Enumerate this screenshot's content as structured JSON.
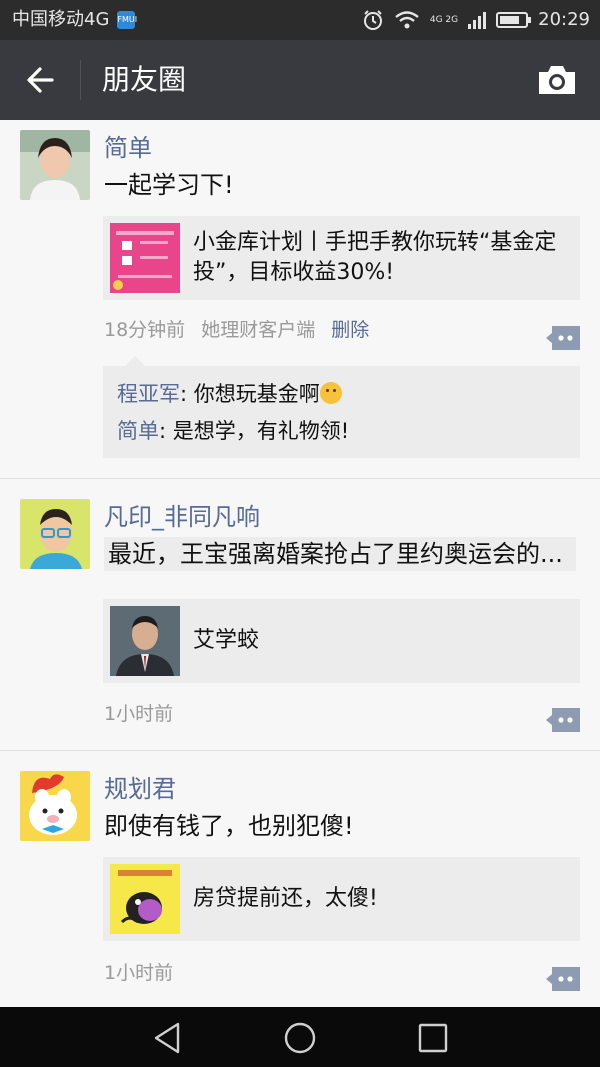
{
  "status_bar": {
    "carrier": "中国移动4G",
    "badge": "FMUI",
    "network": "4G 2G",
    "time": "20:29",
    "battery_level": 0.78
  },
  "header": {
    "title": "朋友圈"
  },
  "posts": [
    {
      "name": "简单",
      "text": "一起学习下!",
      "link": {
        "title": "小金库计划丨手把手教你玩转“基金定投”，目标收益30%!"
      },
      "meta": {
        "time": "18分钟前",
        "source": "她理财客户端",
        "delete": "删除"
      },
      "comments": [
        {
          "who": "程亚军",
          "sep": ": ",
          "text": "你想玩基金啊"
        },
        {
          "who": "简单",
          "sep": ": ",
          "text": "是想学，有礼物领!"
        }
      ]
    },
    {
      "name": "凡印_非同凡响",
      "text": "最近，王宝强离婚案抢占了里约奥运会的...",
      "link": {
        "title": "艾学蛟"
      },
      "meta": {
        "time": "1小时前"
      }
    },
    {
      "name": "规划君",
      "text": "即使有钱了，也别犯傻!",
      "link": {
        "title": "房贷提前还，太傻!"
      },
      "meta": {
        "time": "1小时前"
      }
    }
  ],
  "colors": {
    "title_bar": "#393a3f",
    "status_bar": "#2c2c2c",
    "name_blue": "#576b95",
    "feed_bg": "#f7f7f7"
  }
}
